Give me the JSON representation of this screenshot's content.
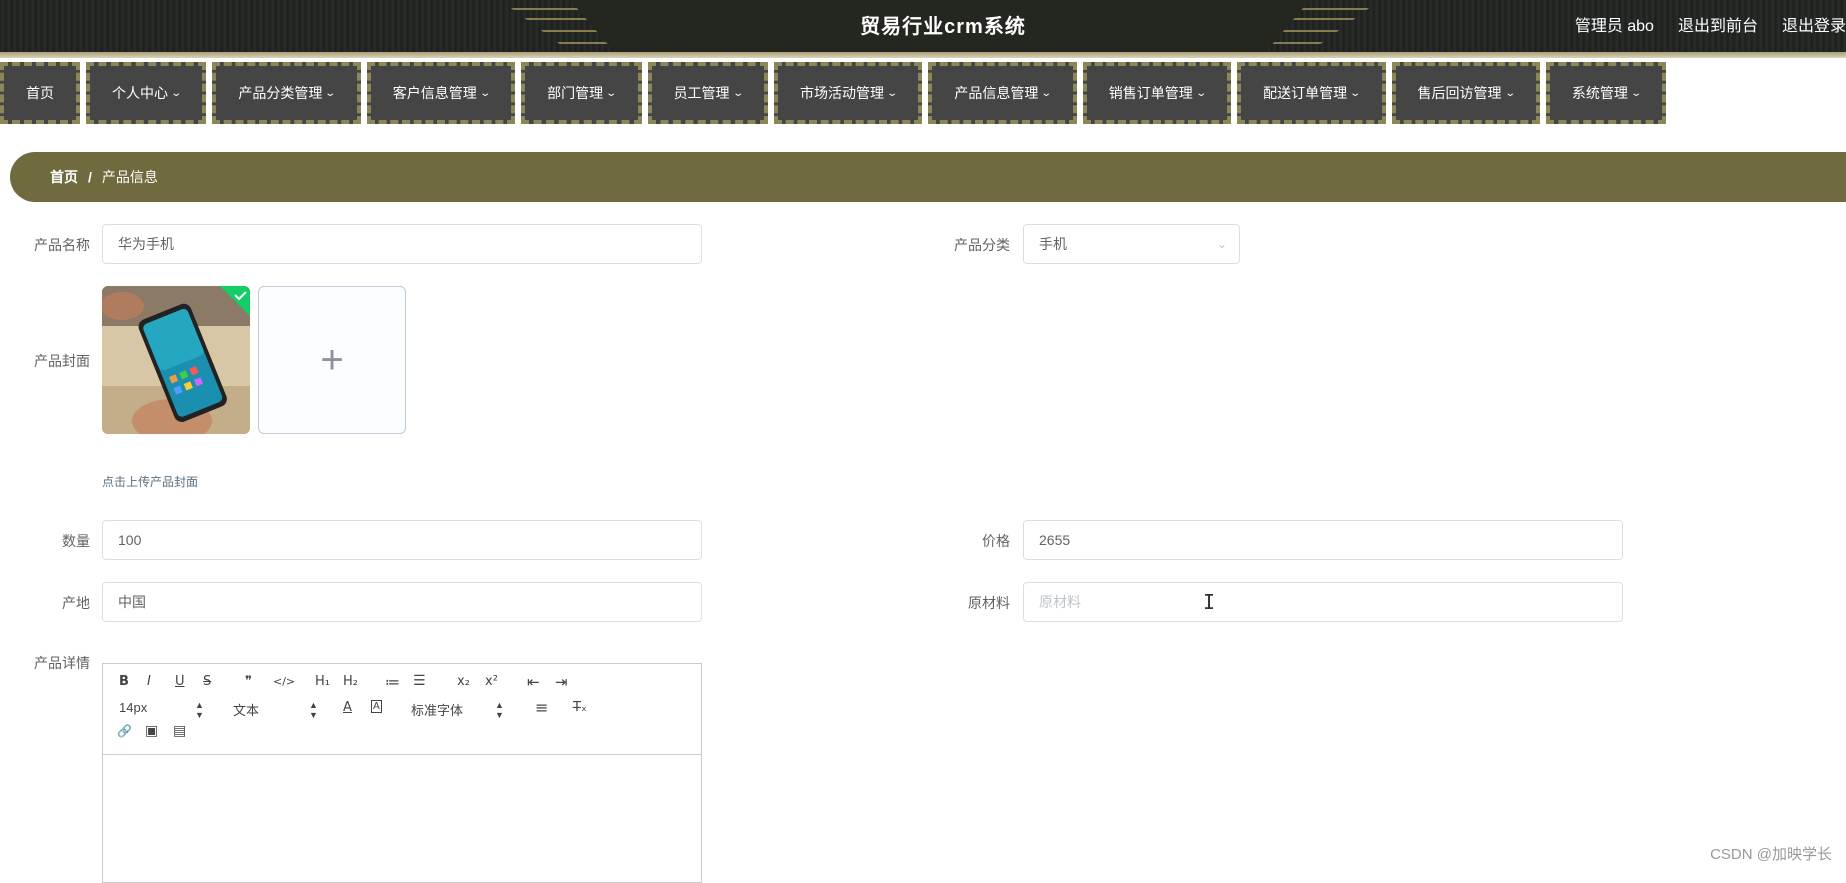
{
  "header": {
    "title": "贸易行业crm系统",
    "user_label": "管理员 abo",
    "to_front_label": "退出到前台",
    "logout_label": "退出登录"
  },
  "nav": {
    "items": [
      {
        "label": "首页",
        "has_dropdown": false
      },
      {
        "label": "个人中心",
        "has_dropdown": true
      },
      {
        "label": "产品分类管理",
        "has_dropdown": true
      },
      {
        "label": "客户信息管理",
        "has_dropdown": true
      },
      {
        "label": "部门管理",
        "has_dropdown": true
      },
      {
        "label": "员工管理",
        "has_dropdown": true
      },
      {
        "label": "市场活动管理",
        "has_dropdown": true
      },
      {
        "label": "产品信息管理",
        "has_dropdown": true
      },
      {
        "label": "销售订单管理",
        "has_dropdown": true
      },
      {
        "label": "配送订单管理",
        "has_dropdown": true
      },
      {
        "label": "售后回访管理",
        "has_dropdown": true
      },
      {
        "label": "系统管理",
        "has_dropdown": true
      }
    ],
    "chevron": "⌄"
  },
  "breadcrumb": {
    "home": "首页",
    "separator": "/",
    "current": "产品信息"
  },
  "form": {
    "product_name": {
      "label": "产品名称",
      "value": "华为手机"
    },
    "category": {
      "label": "产品分类",
      "value": "手机"
    },
    "cover": {
      "label": "产品封面",
      "tip": "点击上传产品封面",
      "add_symbol": "+"
    },
    "quantity": {
      "label": "数量",
      "value": "100"
    },
    "price": {
      "label": "价格",
      "value": "2655"
    },
    "origin": {
      "label": "产地",
      "value": "中国"
    },
    "material": {
      "label": "原材料",
      "placeholder": "原材料"
    },
    "detail": {
      "label": "产品详情"
    }
  },
  "editor": {
    "font_size": "14px",
    "block_type": "文本",
    "font_family": "标准字体",
    "buttons": {
      "bold": "B",
      "italic": "I",
      "underline": "U",
      "strike": "S",
      "quote": "❞",
      "code": "</>",
      "h1": "H₁",
      "h2": "H₂",
      "ol": "≔",
      "ul": "☰",
      "sub": "x₂",
      "sup": "x²",
      "outdent": "⇤",
      "indent": "⇥",
      "color": "A",
      "background": "A",
      "align": "≡",
      "clean": "T̶ₓ",
      "link": "🔗",
      "image": "▣",
      "video": "▤"
    }
  },
  "watermark": "CSDN @加映学长",
  "colors": {
    "nav_bg": "#454545",
    "nav_border": "#8c8758",
    "breadcrumb_bg": "#706b3f",
    "upload_success": "#13ce66"
  }
}
